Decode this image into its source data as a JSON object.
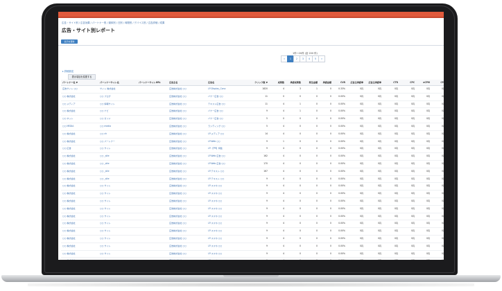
{
  "app": {
    "breadcrumb": "広告・サイト別 / 広告効果 / パートナー別 / 媒体別 / 日別 / 時間別 / デバイス別 / 広告詳細 / 成果",
    "title": "広告・サイト別レポート",
    "action_label": "表示を更新"
  },
  "pager": {
    "info": "1件〜20件 (全 200 件)",
    "pages": [
      "«",
      "1",
      "2",
      "3",
      "4",
      "5",
      "»"
    ],
    "active_index": 1
  },
  "filter": {
    "toggle_label": "▸ 詳細設定",
    "export_label": "表示項目を変更する"
  },
  "table": {
    "columns": [
      "パートナー名 ▼",
      "パートナーサイト名",
      "パートナーサイトURL",
      "広告主名",
      "広告名",
      "クリック数 ▼",
      "成果数",
      "承認成果数",
      "発生金額",
      "承認金額",
      "CVR",
      "広告主承認率",
      "広告主承認率",
      "CTR",
      "CPC",
      "eCPM",
      "CPA"
    ],
    "rows": [
      [
        "広告サイト ○○",
        "サイト 株式会社",
        "",
        "広告株式会社 ○○",
        "LP-Display_Conv",
        "1820",
        "4",
        "3",
        "1",
        "0",
        "0.33%",
        "0円",
        "0円",
        "0円",
        "0円",
        "0円",
        "0円"
      ],
      [
        "○○ 株式会社",
        "○○ ブログ",
        "",
        "広告株式会社 ○○",
        "バナー広告 ○○",
        "11",
        "0",
        "0",
        "0",
        "0",
        "0.00%",
        "0円",
        "0円",
        "0円",
        "0円",
        "0円",
        "0円"
      ],
      [
        "○○ メディア",
        "○○ 情報サイト",
        "",
        "広告株式会社 ○○",
        "テキスト広告 ○○",
        "11",
        "4",
        "1",
        "0",
        "0",
        "0.00%",
        "0円",
        "0円",
        "0円",
        "0円",
        "0円",
        "0円"
      ],
      [
        "○○ 株式会社",
        "○○ ナビ",
        "",
        "広告株式会社 ○○",
        "バナー広告 ○○",
        "9",
        "4",
        "1",
        "0",
        "0",
        "0.00%",
        "0円",
        "0円",
        "0円",
        "0円",
        "0円",
        "0円"
      ],
      [
        "○○ ネット",
        "○○ ガイド",
        "",
        "広告株式会社 ○○",
        "バナー広告 ○○",
        "5",
        "0",
        "0",
        "0",
        "0",
        "0.00%",
        "0円",
        "0円",
        "0円",
        "0円",
        "0円",
        "0円"
      ],
      [
        "○○ MEDIA",
        "○○ media",
        "",
        "広告株式会社 ○○",
        "ランディング ○○",
        "5",
        "4",
        "0",
        "0",
        "0",
        "0.00%",
        "0円",
        "0円",
        "0円",
        "0円",
        "0円",
        "0円"
      ],
      [
        "○○ 株式会社",
        "○○ ch",
        "",
        "広告株式会社 ○○",
        "LP-メディア ○○",
        "14",
        "4",
        "0",
        "0",
        "0",
        "0.00%",
        "0円",
        "0円",
        "0円",
        "0円",
        "0円",
        "0円"
      ],
      [
        "○○ 株式会社",
        "○○ パートナー",
        "",
        "広告株式会社 ○○",
        "LP-Web ○○",
        "9",
        "1",
        "0",
        "0",
        "0",
        "0.00%",
        "0円",
        "0円",
        "0円",
        "0円",
        "0円",
        "0円"
      ],
      [
        "○○ 広告",
        "○○ サイト",
        "",
        "広告株式会社 ○○",
        "LP-【PR】特集",
        "9",
        "4",
        "0",
        "0",
        "0",
        "0.00%",
        "0円",
        "0円",
        "0円",
        "0円",
        "0円",
        "0円"
      ],
      [
        "○○ 株式会社",
        "○○ _site",
        "",
        "広告株式会社 ○○",
        "LP-Web 広告 ○○",
        "162",
        "4",
        "0",
        "0",
        "0",
        "0.00%",
        "0円",
        "0円",
        "0円",
        "0円",
        "0円",
        "0円"
      ],
      [
        "○○ 株式会社",
        "○○ _site",
        "",
        "広告株式会社 ○○",
        "LP-Web 広告 ○○",
        "170",
        "4",
        "0",
        "0",
        "0",
        "0.00%",
        "0円",
        "0円",
        "0円",
        "0円",
        "0円",
        "0円"
      ],
      [
        "○○ 株式会社",
        "○○ _site",
        "",
        "広告株式会社 ○○",
        "LP-テキスト ○○",
        "167",
        "4",
        "0",
        "0",
        "0",
        "0.00%",
        "0円",
        "0円",
        "0円",
        "0円",
        "0円",
        "0円"
      ],
      [
        "○○ 株式会社",
        "○○ _site",
        "",
        "広告株式会社 ○○",
        "LP-テキスト ○○",
        "9",
        "4",
        "0",
        "0",
        "0",
        "0.00%",
        "0円",
        "0円",
        "0円",
        "0円",
        "0円",
        "0円"
      ],
      [
        "○○ 株式会社",
        "○○ サイト",
        "",
        "広告株式会社 ○○",
        "LP-スマホ ○○",
        "9",
        "4",
        "0",
        "0",
        "0",
        "0.00%",
        "0円",
        "0円",
        "0円",
        "0円",
        "0円",
        "0円"
      ],
      [
        "○○ 株式会社",
        "○○ サイト",
        "",
        "広告株式会社 ○○",
        "LP-スマホ ○○",
        "9",
        "4",
        "0",
        "0",
        "0",
        "0.00%",
        "0円",
        "0円",
        "0円",
        "0円",
        "0円",
        "0円"
      ],
      [
        "○○ 株式会社",
        "○○ サイト",
        "",
        "広告株式会社 ○○",
        "LP-スマホ ○○",
        "9",
        "4",
        "0",
        "0",
        "0",
        "0.00%",
        "0円",
        "0円",
        "0円",
        "0円",
        "0円",
        "0円"
      ],
      [
        "○○ 株式会社",
        "○○ サイト",
        "",
        "広告株式会社 ○○",
        "LP-スマホ ○○",
        "9",
        "4",
        "0",
        "0",
        "0",
        "0.00%",
        "0円",
        "0円",
        "0円",
        "0円",
        "0円",
        "0円"
      ],
      [
        "○○ 株式会社",
        "○○ サイト",
        "",
        "広告株式会社 ○○",
        "LP-スマホ ○○",
        "9",
        "4",
        "0",
        "0",
        "0",
        "0.00%",
        "0円",
        "0円",
        "0円",
        "0円",
        "0円",
        "0円"
      ],
      [
        "○○ 株式会社",
        "○○ サイト",
        "",
        "広告株式会社 ○○",
        "LP-スマホ ○○",
        "9",
        "4",
        "0",
        "0",
        "0",
        "0.00%",
        "0円",
        "0円",
        "0円",
        "0円",
        "0円",
        "0円"
      ],
      [
        "○○ 株式会社",
        "○○ サイト",
        "",
        "広告株式会社 ○○",
        "LP-スマホ ○○",
        "9",
        "4",
        "0",
        "0",
        "0",
        "0.00%",
        "0円",
        "0円",
        "0円",
        "0円",
        "0円",
        "0円"
      ],
      [
        "○○ 株式会社",
        "○○ サイト",
        "",
        "広告株式会社 ○○",
        "LP-スマホ ○○",
        "9",
        "4",
        "0",
        "0",
        "0",
        "0.00%",
        "0円",
        "0円",
        "0円",
        "0円",
        "0円",
        "0円"
      ],
      [
        "○○ 株式会社",
        "○○ サイト",
        "",
        "広告株式会社 ○○",
        "LP-スマホ ○○",
        "9",
        "4",
        "0",
        "0",
        "0",
        "0.00%",
        "0円",
        "0円",
        "0円",
        "0円",
        "0円",
        "0円"
      ],
      [
        "○○ 株式会社",
        "○○ サイト",
        "",
        "広告株式会社 ○○",
        "LP-スマホ ○○",
        "9",
        "4",
        "0",
        "0",
        "0",
        "0.00%",
        "0円",
        "0円",
        "0円",
        "0円",
        "0円",
        "0円"
      ],
      [
        "○○ 株式会社",
        "○○ サイト",
        "",
        "広告株式会社 ○○",
        "LP-スマホ ○○",
        "9",
        "4",
        "0",
        "0",
        "0",
        "0.00%",
        "0円",
        "0円",
        "0円",
        "0円",
        "0円",
        "0円"
      ],
      [
        "○○ 株式会社",
        "○○ サイト",
        "",
        "広告株式会社 ○○",
        "LP-スマホ ○○",
        "9",
        "4",
        "0",
        "0",
        "0",
        "0.00%",
        "0円",
        "0円",
        "0円",
        "0円",
        "0円",
        "0円"
      ]
    ]
  },
  "colors": {
    "accent": "#3e7fc1",
    "topbar": "#e15a3c",
    "link": "#3a6fb0"
  }
}
